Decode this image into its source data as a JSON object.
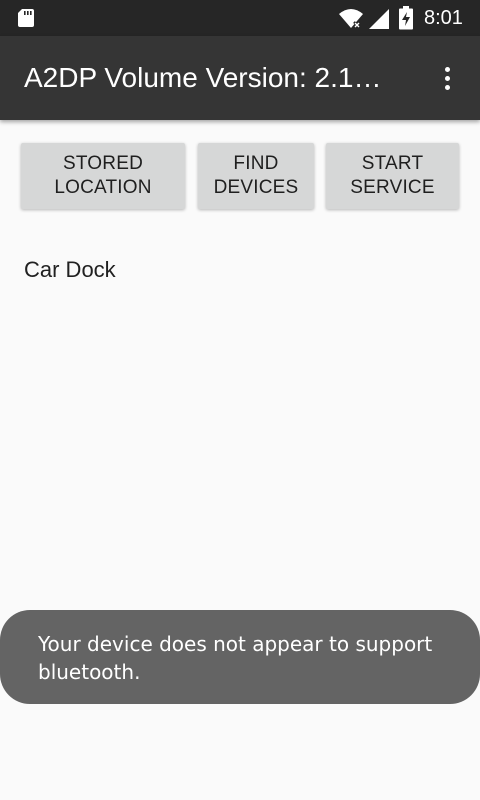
{
  "status_bar": {
    "time": "8:01",
    "icons": [
      "sd-card-icon",
      "wifi-icon",
      "cell-signal-icon",
      "battery-charging-icon"
    ]
  },
  "app_bar": {
    "title": "A2DP Volume Version: 2.1…",
    "overflow_icon": "more-vert-icon"
  },
  "buttons": {
    "stored_location": "STORED\nLOCATION",
    "find_devices": "FIND\nDEVICES",
    "start_service": "START\nSERVICE"
  },
  "devices": [
    {
      "label": "Car Dock"
    }
  ],
  "toast": {
    "message": "Your device does not appear to support bluetooth."
  },
  "colors": {
    "status_bar": "#262626",
    "app_bar": "#353535",
    "background": "#fafafa",
    "button": "#d6d7d7",
    "toast": "#646464"
  }
}
